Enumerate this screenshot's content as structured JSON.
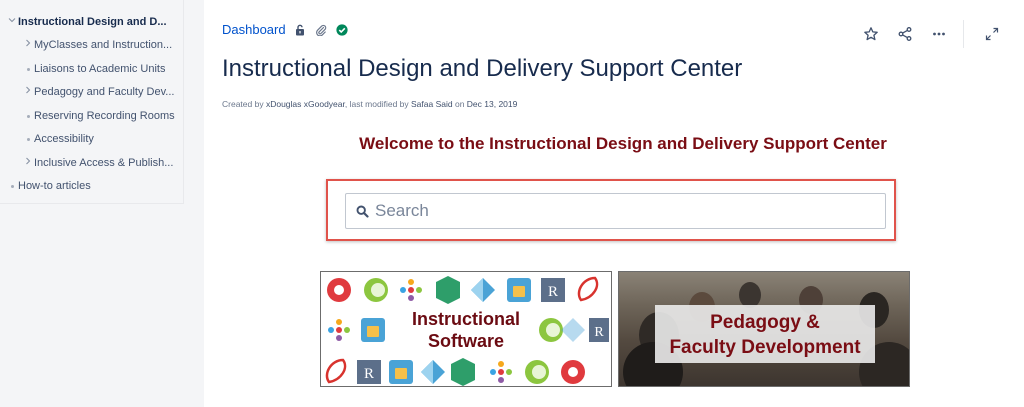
{
  "sidebar": {
    "items": [
      {
        "label": "Instructional Design and D...",
        "marker": "chevron-down"
      },
      {
        "label": "MyClasses and Instruction...",
        "marker": "chevron-right"
      },
      {
        "label": "Liaisons to Academic Units",
        "marker": "dot"
      },
      {
        "label": "Pedagogy and Faculty Dev...",
        "marker": "chevron-right"
      },
      {
        "label": "Reserving Recording Rooms",
        "marker": "dot"
      },
      {
        "label": "Accessibility",
        "marker": "dot"
      },
      {
        "label": "Inclusive Access & Publish...",
        "marker": "chevron-right"
      },
      {
        "label": "How-to articles",
        "marker": "dot"
      }
    ]
  },
  "breadcrumb": {
    "dashboard": "Dashboard",
    "icons": [
      "unlock-icon",
      "attachment-icon",
      "verified-check-icon"
    ]
  },
  "page": {
    "title": "Instructional Design and Delivery Support Center",
    "meta_created": "Created by ",
    "meta_author": "xDouglas xGoodyear",
    "meta_mid": ", last modified by ",
    "meta_modifier": "Safaa Said",
    "meta_on": " on ",
    "meta_date": "Dec 13, 2019"
  },
  "content": {
    "welcome": "Welcome to the Instructional Design and Delivery Support Center",
    "search_placeholder": "Search",
    "tiles": [
      {
        "line1": "Instructional",
        "line2": "Software"
      },
      {
        "line1": "Pedagogy &",
        "line2": "Faculty Development"
      }
    ]
  },
  "colors": {
    "accent": "#0052cc",
    "welcome": "#7a0d14",
    "highlight": "#e0534b"
  }
}
